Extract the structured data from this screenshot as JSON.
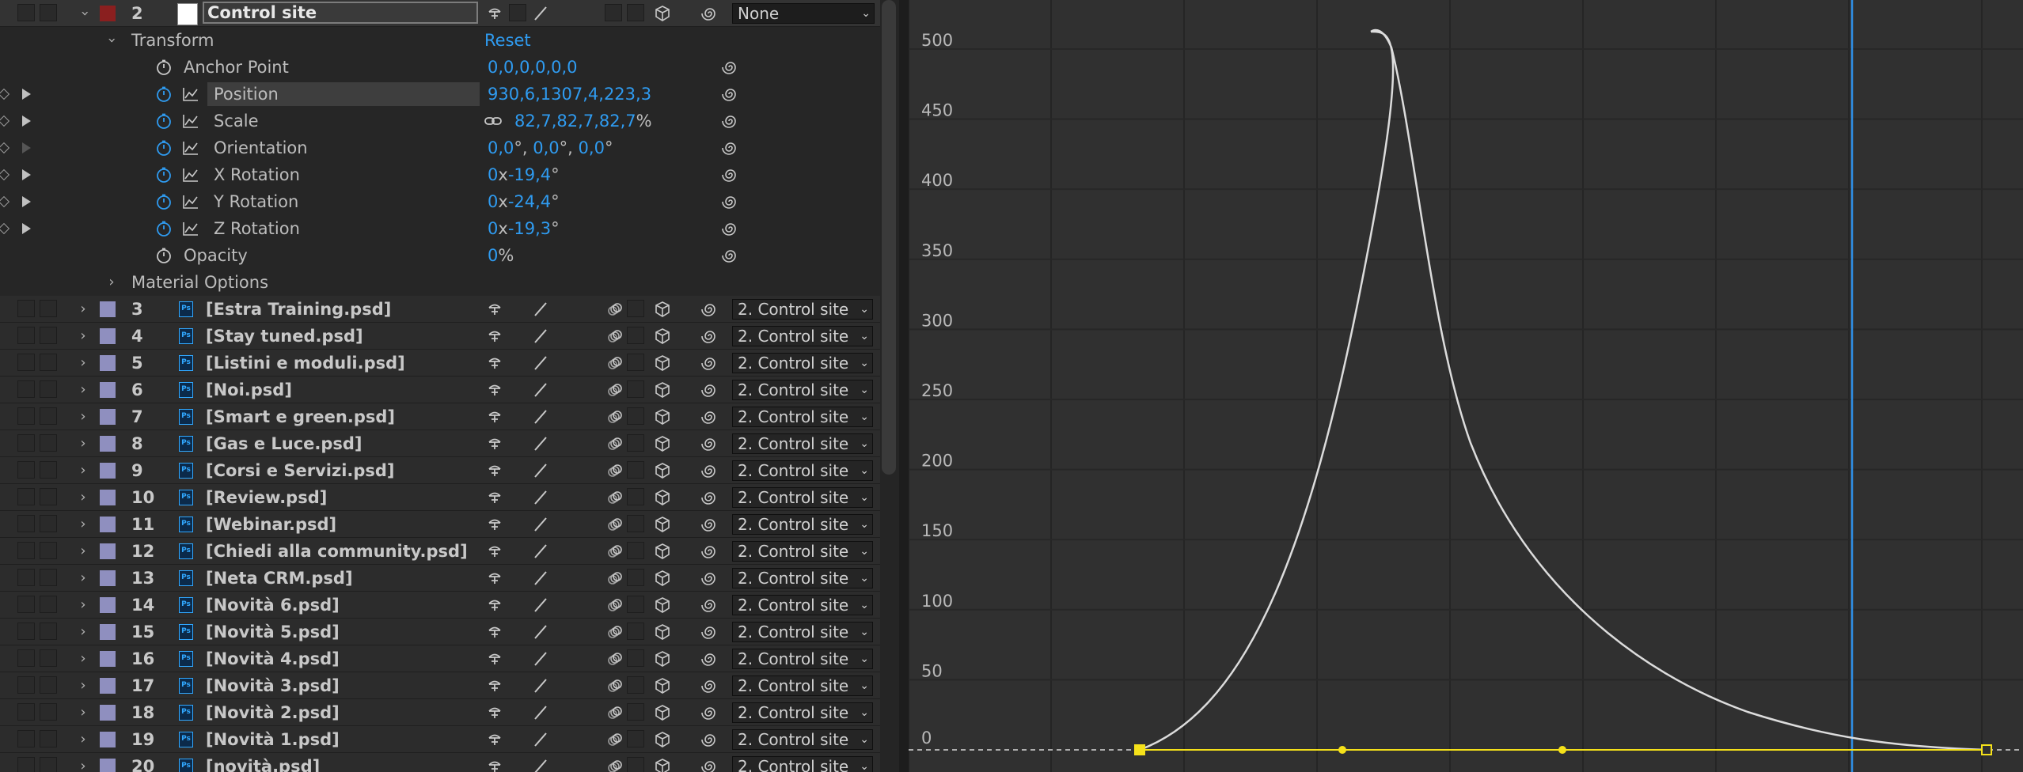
{
  "layer_header": {
    "number": "2",
    "name": "Control site",
    "parent": "None"
  },
  "transform": {
    "label": "Transform",
    "reset": "Reset",
    "properties": [
      {
        "name": "Anchor Point",
        "value_parts": [
          "0,0,0,0,0,0"
        ]
      },
      {
        "name": "Position",
        "value_parts": [
          "930,6,1307,4,223,3"
        ]
      },
      {
        "name": "Scale",
        "value_parts": [
          "82,7,82,7,82,7",
          "%"
        ]
      },
      {
        "name": "Orientation",
        "value_parts": [
          "0,0",
          "°, ",
          "0,0",
          "°, ",
          "0,0",
          "°"
        ]
      },
      {
        "name": "X Rotation",
        "value_parts": [
          "0",
          "x",
          "-19,4",
          "°"
        ]
      },
      {
        "name": "Y Rotation",
        "value_parts": [
          "0",
          "x",
          "-24,4",
          "°"
        ]
      },
      {
        "name": "Z Rotation",
        "value_parts": [
          "0",
          "x",
          "-19,3",
          "°"
        ]
      },
      {
        "name": "Opacity",
        "value_parts": [
          "0",
          "%"
        ]
      }
    ]
  },
  "material_options": "Material Options",
  "layers": [
    {
      "num": "3",
      "name": "[Estra Training.psd]",
      "parent": "2. Control site"
    },
    {
      "num": "4",
      "name": "[Stay tuned.psd]",
      "parent": "2. Control site"
    },
    {
      "num": "5",
      "name": "[Listini e moduli.psd]",
      "parent": "2. Control site"
    },
    {
      "num": "6",
      "name": "[Noi.psd]",
      "parent": "2. Control site"
    },
    {
      "num": "7",
      "name": "[Smart e green.psd]",
      "parent": "2. Control site"
    },
    {
      "num": "8",
      "name": "[Gas e Luce.psd]",
      "parent": "2. Control site"
    },
    {
      "num": "9",
      "name": "[Corsi e Servizi.psd]",
      "parent": "2. Control site"
    },
    {
      "num": "10",
      "name": "[Review.psd]",
      "parent": "2. Control site"
    },
    {
      "num": "11",
      "name": "[Webinar.psd]",
      "parent": "2. Control site"
    },
    {
      "num": "12",
      "name": "[Chiedi alla community.psd]",
      "parent": "2. Control site"
    },
    {
      "num": "13",
      "name": "[Neta CRM.psd]",
      "parent": "2. Control site"
    },
    {
      "num": "14",
      "name": "[Novità 6.psd]",
      "parent": "2. Control site"
    },
    {
      "num": "15",
      "name": "[Novità 5.psd]",
      "parent": "2. Control site"
    },
    {
      "num": "16",
      "name": "[Novità 4.psd]",
      "parent": "2. Control site"
    },
    {
      "num": "17",
      "name": "[Novità 3.psd]",
      "parent": "2. Control site"
    },
    {
      "num": "18",
      "name": "[Novità 2.psd]",
      "parent": "2. Control site"
    },
    {
      "num": "19",
      "name": "[Novità 1.psd]",
      "parent": "2. Control site"
    },
    {
      "num": "20",
      "name": "[novità.psd]",
      "parent": "2. Control site"
    }
  ],
  "graph": {
    "y_ticks": [
      "500",
      "450",
      "400",
      "350",
      "300",
      "250",
      "200",
      "150",
      "100",
      "50",
      "0"
    ],
    "curve_color": "#dcdcdc",
    "keyframe_color": "#f5e11a",
    "playhead_color": "#2f8fe6"
  },
  "colors": {
    "accent_blue": "#2f9bf0",
    "layer_label_red": "#8a1f1f",
    "layer_label_lavender": "#8f8fbf"
  },
  "icons": {
    "stopwatch": "stopwatch-icon",
    "graph": "graph-icon",
    "link": "link-icon",
    "spiral": "pickwhip-icon",
    "shy": "shy-icon",
    "fx": "quality-icon",
    "cube": "3d-cube-icon",
    "motion_blur": "motion-blur-icon",
    "ps": "photoshop-file-icon"
  }
}
